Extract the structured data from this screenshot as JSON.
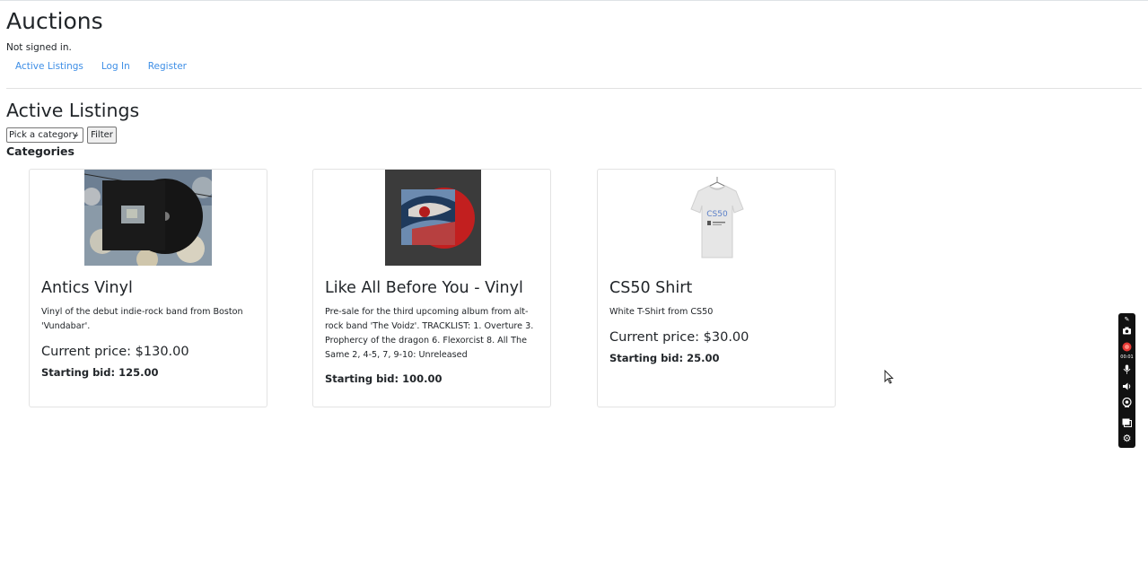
{
  "header": {
    "title": "Auctions",
    "signin_status": "Not signed in."
  },
  "nav": {
    "items": [
      {
        "label": "Active Listings"
      },
      {
        "label": "Log In"
      },
      {
        "label": "Register"
      }
    ]
  },
  "main": {
    "title": "Active Listings",
    "filter": {
      "select_value": "Pick a category",
      "button_label": "Filter"
    },
    "categories_heading": "Categories",
    "listings": [
      {
        "title": "Antics Vinyl",
        "description": "Vinyl of the debut indie-rock band from Boston 'Vundabar'.",
        "current_price": "Current price: $130.00",
        "starting_bid": "Starting bid: 125.00"
      },
      {
        "title": "Like All Before You - Vinyl",
        "description": "Pre-sale for the third upcoming album from alt-rock band 'The Voidz'. TRACKLIST: 1. Overture 3. Prophercy of the dragon 6. Flexorcist 8. All The Same 2, 4-5, 7, 9-10: Unreleased",
        "current_price": "",
        "starting_bid": "Starting bid: 100.00"
      },
      {
        "title": "CS50 Shirt",
        "description": "White T-Shirt from CS50",
        "current_price": "Current price: $30.00",
        "starting_bid": "Starting bid: 25.00"
      }
    ]
  },
  "recorder": {
    "timer": "00:01",
    "icons": [
      "feather-icon",
      "camera-icon",
      "record-icon",
      "microphone-icon",
      "speaker-icon",
      "webcam-icon",
      "window-icon",
      "gear-icon"
    ],
    "record_color": "#e53935"
  },
  "colors": {
    "link": "#3d8ee6",
    "text": "#212529"
  }
}
